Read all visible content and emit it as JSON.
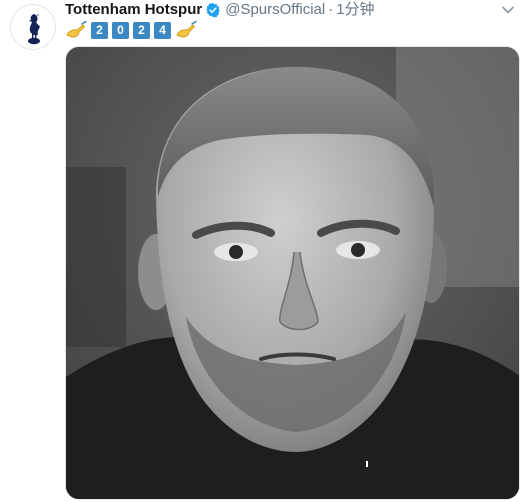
{
  "tweet": {
    "display_name": "Tottenham Hotspur",
    "handle": "@SpursOfficial",
    "separator": "·",
    "time": "1分钟",
    "text_digits": [
      "2",
      "0",
      "2",
      "4"
    ]
  },
  "icons": {
    "avatar": "tottenham-cockerel-logo",
    "verified": "verified-badge-icon",
    "menu": "chevron-down-icon",
    "emoji": "writing-hand-emoji"
  },
  "colors": {
    "verified": "#1da1f2",
    "keycap": "#3b88c3",
    "secondary_text": "#657786"
  }
}
